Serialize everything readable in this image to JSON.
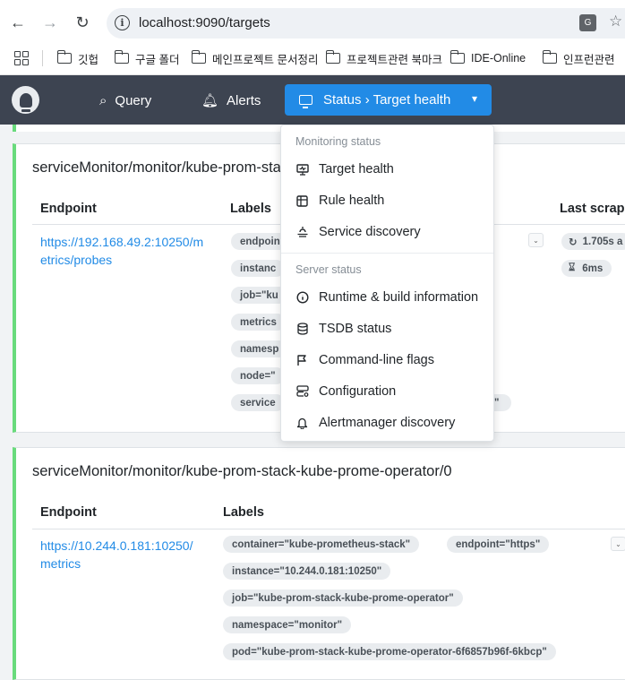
{
  "browser": {
    "url": "localhost:9090/targets",
    "bookmarks": [
      "깃헙",
      "구글 폴더",
      "메인프로젝트 문서정리",
      "프로젝트관련 북마크",
      "IDE-Online",
      "인프런관련"
    ]
  },
  "header": {
    "nav": {
      "query": "Query",
      "alerts": "Alerts"
    },
    "status_button": "Status › Target health"
  },
  "dropdown": {
    "monitoring_section": "Monitoring status",
    "monitoring_items": [
      "Target health",
      "Rule health",
      "Service discovery"
    ],
    "server_section": "Server status",
    "server_items": [
      "Runtime & build information",
      "TSDB status",
      "Command-line flags",
      "Configuration",
      "Alertmanager discovery"
    ]
  },
  "cards": [
    {
      "title": "serviceMonitor/monitor/kube-prom-sta",
      "columns": {
        "endpoint": "Endpoint",
        "labels": "Labels",
        "last_scrape": "Last scrape"
      },
      "endpoint_line1": "https://192.168.49.2:10250/m",
      "endpoint_line2": "etrics/probes",
      "labels": [
        "endpoin",
        "instanc",
        "job=\"ku",
        "metrics",
        "namesp",
        "node=\"",
        "service"
      ],
      "trailing_label": "\"",
      "scrape_duration": "1.705s a",
      "scrape_time": "6ms"
    },
    {
      "title": "serviceMonitor/monitor/kube-prom-stack-kube-prome-operator/0",
      "columns": {
        "endpoint": "Endpoint",
        "labels": "Labels"
      },
      "endpoint_line1": "https://10.244.0.181:10250/",
      "endpoint_line2": "metrics",
      "labels": [
        "container=\"kube-prometheus-stack\"",
        "endpoint=\"https\"",
        "instance=\"10.244.0.181:10250\"",
        "job=\"kube-prom-stack-kube-prome-operator\"",
        "namespace=\"monitor\"",
        "pod=\"kube-prom-stack-kube-prome-operator-6f6857b96f-6kbcp\""
      ]
    }
  ],
  "colors": {
    "header_bg": "#3d4451",
    "accent": "#228be6",
    "healthy": "#69db7c"
  }
}
